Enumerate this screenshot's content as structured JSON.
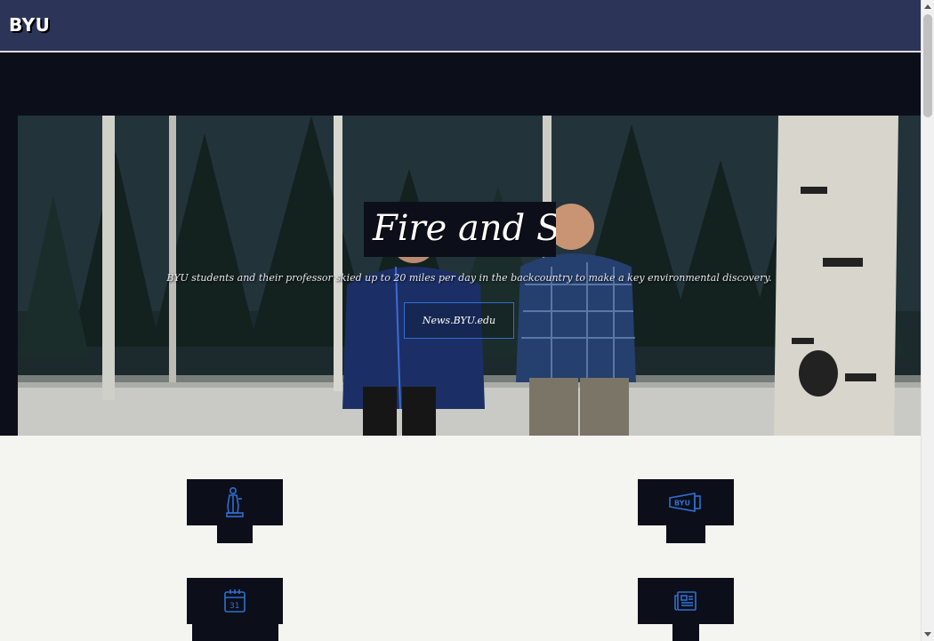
{
  "header": {
    "logo_text": "BYU",
    "background": "#2c3458"
  },
  "hero": {
    "title": "Fire and Snow",
    "subtitle": "BYU students and their professor skied up to 20 miles per day in the backcountry to make a key environmental discovery.",
    "link_label": "News.BYU.edu"
  },
  "tiles": [
    {
      "icon": "person-statue-icon",
      "label": ""
    },
    {
      "icon": "byu-megaphone-icon",
      "label": ""
    },
    {
      "icon": "calendar-icon",
      "label": ""
    },
    {
      "icon": "newspaper-icon",
      "label": ""
    }
  ],
  "colors": {
    "accent": "#2f6fd0",
    "dark": "#0c0f1a",
    "page_bg": "#f4f4f1"
  }
}
